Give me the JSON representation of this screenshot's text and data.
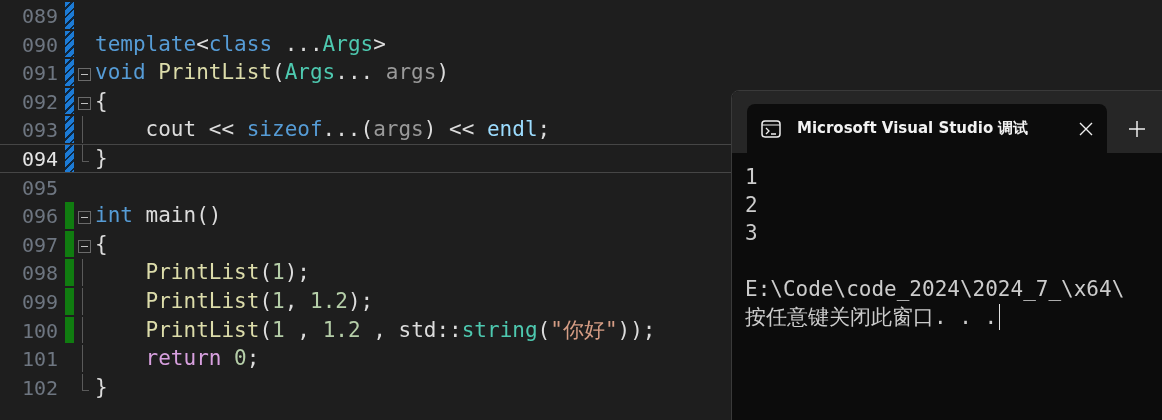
{
  "editor": {
    "lines": [
      {
        "number": "089",
        "color": "#1c7bd6",
        "kind": "plain",
        "current": false
      },
      {
        "number": "090",
        "color": "#1c7bd6",
        "kind": "plain",
        "current": false,
        "tokens": [
          {
            "text": "template",
            "kind": "keyword"
          },
          {
            "text": "<",
            "kind": "plain"
          },
          {
            "text": "class",
            "kind": "keyword"
          },
          {
            "text": " ...",
            "kind": "plain"
          },
          {
            "text": "Args",
            "kind": "type"
          },
          {
            "text": ">",
            "kind": "plain"
          }
        ]
      },
      {
        "number": "091",
        "color": "#1c7bd6",
        "kind": "fold-start",
        "current": false,
        "tokens": [
          {
            "text": "void",
            "kind": "keyword"
          },
          {
            "text": " PrintList",
            "kind": "func"
          },
          {
            "text": "(",
            "kind": "plain"
          },
          {
            "text": "Args",
            "kind": "type"
          },
          {
            "text": "... ",
            "kind": "plain"
          },
          {
            "text": "args",
            "kind": "param"
          },
          {
            "text": ")",
            "kind": "plain"
          }
        ]
      },
      {
        "number": "092",
        "color": "#1c7bd6",
        "kind": "fold-start",
        "current": false,
        "tokens": [
          {
            "text": "{",
            "kind": "plain"
          }
        ]
      },
      {
        "number": "093",
        "color": "#1c7bd6",
        "kind": "fold-body",
        "current": false,
        "tokens": [
          {
            "text": "    cout << ",
            "kind": "plain"
          },
          {
            "text": "sizeof",
            "kind": "keyword"
          },
          {
            "text": "...(",
            "kind": "plain"
          },
          {
            "text": "args",
            "kind": "param"
          },
          {
            "text": ") << ",
            "kind": "plain"
          },
          {
            "text": "endl",
            "kind": "var"
          },
          {
            "text": ";",
            "kind": "plain"
          }
        ]
      },
      {
        "number": "094",
        "color": "#1c7bd6",
        "kind": "fold-end",
        "current": true,
        "tokens": [
          {
            "text": "}",
            "kind": "plain"
          }
        ]
      },
      {
        "number": "095",
        "kind": "plain",
        "current": false
      },
      {
        "number": "096",
        "color": "#107c10",
        "kind": "fold-start",
        "current": false,
        "tokens": [
          {
            "text": "int",
            "kind": "keyword"
          },
          {
            "text": " main()",
            "kind": "plain"
          }
        ]
      },
      {
        "number": "097",
        "color": "#107c10",
        "kind": "fold-start",
        "current": false,
        "tokens": [
          {
            "text": "{",
            "kind": "plain"
          }
        ]
      },
      {
        "number": "098",
        "color": "#107c10",
        "kind": "fold-body",
        "current": false,
        "tokens": [
          {
            "text": "    PrintList",
            "kind": "func"
          },
          {
            "text": "(",
            "kind": "plain"
          },
          {
            "text": "1",
            "kind": "number"
          },
          {
            "text": ");",
            "kind": "plain"
          }
        ]
      },
      {
        "number": "099",
        "color": "#107c10",
        "kind": "fold-body",
        "current": false,
        "tokens": [
          {
            "text": "    PrintList",
            "kind": "func"
          },
          {
            "text": "(",
            "kind": "plain"
          },
          {
            "text": "1",
            "kind": "number"
          },
          {
            "text": ", ",
            "kind": "plain"
          },
          {
            "text": "1.2",
            "kind": "number"
          },
          {
            "text": ");",
            "kind": "plain"
          }
        ]
      },
      {
        "number": "100",
        "color": "#107c10",
        "kind": "fold-body",
        "current": false,
        "tokens": [
          {
            "text": "    PrintList",
            "kind": "func"
          },
          {
            "text": "(",
            "kind": "plain"
          },
          {
            "text": "1",
            "kind": "number"
          },
          {
            "text": " , ",
            "kind": "plain"
          },
          {
            "text": "1.2",
            "kind": "number"
          },
          {
            "text": " , std::",
            "kind": "plain"
          },
          {
            "text": "string",
            "kind": "type"
          },
          {
            "text": "(",
            "kind": "plain"
          },
          {
            "text": "\"你好\"",
            "kind": "string"
          },
          {
            "text": "));",
            "kind": "plain"
          }
        ]
      },
      {
        "number": "101",
        "kind": "fold-body",
        "current": false,
        "tokens": [
          {
            "text": "    return",
            "kind": "control"
          },
          {
            "text": " 0",
            "kind": "number"
          },
          {
            "text": ";",
            "kind": "plain"
          }
        ]
      },
      {
        "number": "102",
        "kind": "fold-end",
        "current": false,
        "tokens": [
          {
            "text": "}",
            "kind": "plain"
          }
        ]
      }
    ]
  },
  "terminal": {
    "tabs": [
      {
        "title": "Microsoft Visual Studio 调试",
        "selected": true
      }
    ],
    "output": [
      [
        "1",
        "2",
        "3"
      ],
      [
        "E:\\Code\\code_2024\\2024_7_\\x64\\",
        "按任意键关闭此窗口. . ."
      ]
    ]
  }
}
